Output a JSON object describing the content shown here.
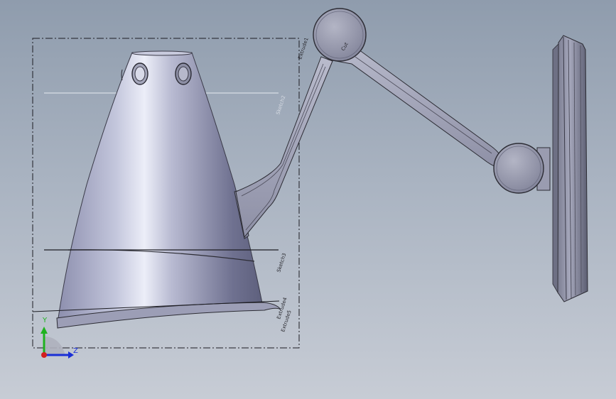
{
  "viewport": {
    "background_top": "#8f9cad",
    "background_bottom": "#c7ccd5"
  },
  "model": {
    "body_color": "#9ea0b8",
    "highlight_color": "#e6e8f4",
    "edge_color": "#2c2c34"
  },
  "sketch_labels": {
    "top_right": "Extrude1",
    "arm_mid": "Sketch2",
    "shade_upper": "Sketch3",
    "shade_lower": "Extrude4",
    "shade_bottom": "Extrude5",
    "pivot_top": "Cut"
  },
  "triad": {
    "y_label": "Y",
    "z_label": "Z",
    "y_color": "#1fb21f",
    "z_color": "#1a2fd6",
    "x_color": "#d21f1f"
  }
}
